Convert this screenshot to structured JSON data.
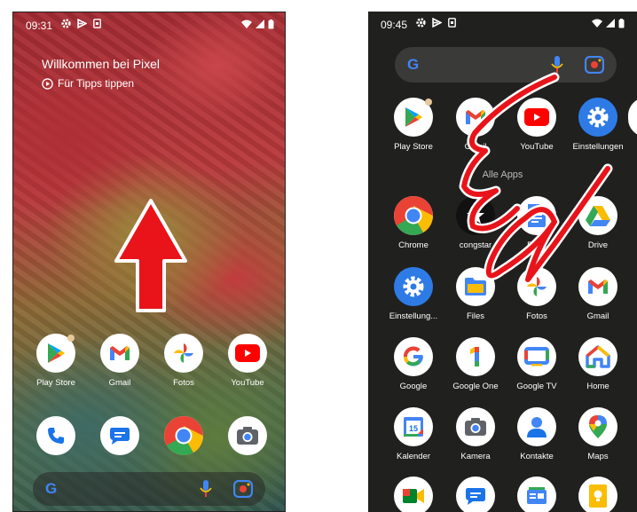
{
  "left": {
    "status": {
      "time": "09:31"
    },
    "welcome_title": "Willkommen bei Pixel",
    "tips_text": "Für Tipps tippen",
    "apps": [
      {
        "label": "Play Store"
      },
      {
        "label": "Gmail"
      },
      {
        "label": "Fotos"
      },
      {
        "label": "YouTube"
      }
    ],
    "search_logo": "G"
  },
  "right": {
    "status": {
      "time": "09:45"
    },
    "search_logo": "G",
    "section_title": "Alle Apps",
    "apps": [
      {
        "label": "Play Store"
      },
      {
        "label": "Gmail"
      },
      {
        "label": "YouTube"
      },
      {
        "label": "Einstellungen"
      },
      {
        "label": "Chrome"
      },
      {
        "label": "congstar"
      },
      {
        "label": "Docs"
      },
      {
        "label": "Drive"
      },
      {
        "label": "Einstellung..."
      },
      {
        "label": "Files"
      },
      {
        "label": "Fotos"
      },
      {
        "label": "Gmail"
      },
      {
        "label": "Google"
      },
      {
        "label": "Google One"
      },
      {
        "label": "Google TV"
      },
      {
        "label": "Home"
      },
      {
        "label": "Kalender"
      },
      {
        "label": "Kamera"
      },
      {
        "label": "Kontakte"
      },
      {
        "label": "Maps"
      }
    ],
    "calendar_day": "15"
  },
  "colors": {
    "annotation_red": "#e8141a",
    "drawer_bg": "#20201f"
  }
}
